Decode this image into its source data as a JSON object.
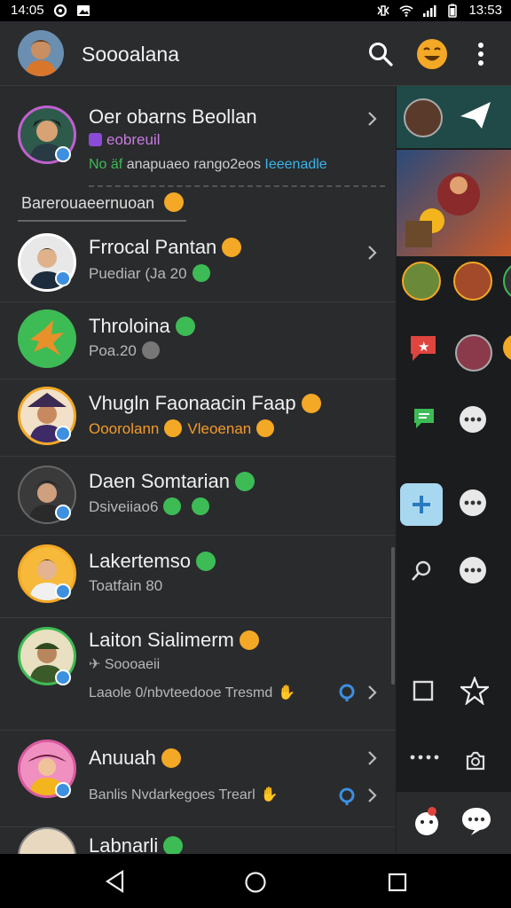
{
  "status_bar": {
    "left_text": "14:05",
    "time": "13:53"
  },
  "app_bar": {
    "title": "Soooalana"
  },
  "profile": {
    "name": "Oer obarns Beollan",
    "tag": "eobreuil",
    "status_green": "No äf",
    "status_rest": "anapuaeo rango2eos",
    "status_link": "Ieeenadle"
  },
  "section_header": "Barerouaeernuoan",
  "chats": [
    {
      "name": "Frrocal Pantan",
      "sub": "Puediar (Ja 20"
    },
    {
      "name": "Throloina",
      "sub": "Poa.20"
    },
    {
      "name": "Vhugln Faonaacin Faap",
      "sub_a": "Ooorolann",
      "sub_b": "Vleoenan"
    },
    {
      "name": "Daen Somtarian",
      "sub": "Dsiveiiao6"
    },
    {
      "name": "Lakertemso",
      "sub": "Toatfain 80"
    },
    {
      "name": "Laiton Sialimerm",
      "sub": "Soooaeii",
      "preview": "Laaole 0/nbvteedooe Tresmd"
    },
    {
      "name": "Anuuah",
      "preview": "Banlis Nvdarkegoes Trearl"
    },
    {
      "name": "Labnarli"
    }
  ],
  "icons": {
    "search": "search-icon",
    "emoji": "smiley-emoji-icon",
    "more": "more-vertical-icon",
    "chevron": "chevron-right-icon"
  },
  "colors": {
    "accent_blue": "#3d8fe0",
    "link_teal": "#3ab4e8",
    "green": "#3dbb55",
    "orange": "#f39a2b",
    "emoji_yellow": "#f3a826"
  }
}
